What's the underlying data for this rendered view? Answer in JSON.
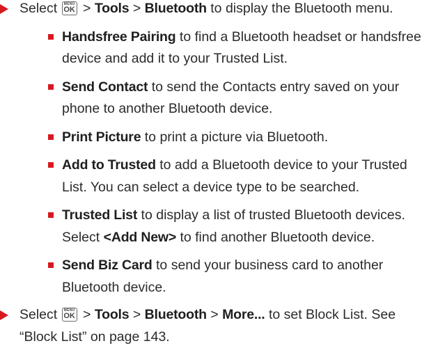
{
  "key_icon": {
    "top": "MENU",
    "bottom": "OK"
  },
  "step1": {
    "select": "Select",
    "sep1": " > ",
    "tools": "Tools",
    "sep2": " > ",
    "bluetooth": "Bluetooth",
    "rest": " to display the Bluetooth menu."
  },
  "items": [
    {
      "term": "Handsfree Pairing",
      "desc": " to find a Bluetooth headset or handsfree device and add it to your Trusted List."
    },
    {
      "term": "Send Contact",
      "desc": " to send the Contacts entry saved on your phone to another Bluetooth device."
    },
    {
      "term": "Print Picture",
      "desc": " to print a picture via Bluetooth."
    },
    {
      "term": "Add to Trusted",
      "desc": " to add a Bluetooth device to your Trusted List. You can select a device type to be searched."
    },
    {
      "term": "Trusted List",
      "desc": " to display a list of trusted Bluetooth devices. Select ",
      "term2": "<Add New>",
      "desc2": " to find another Bluetooth device."
    },
    {
      "term": "Send Biz Card",
      "desc": " to send your business card to another Bluetooth device."
    }
  ],
  "step2": {
    "select": "Select",
    "sep1": " > ",
    "tools": "Tools",
    "sep2": " > ",
    "bluetooth": "Bluetooth",
    "sep3": " > ",
    "more": "More...",
    "rest": " to set Block List. See “Block List” on page 143."
  },
  "colors": {
    "accent": "#d7191f",
    "text": "#2b2b2b"
  }
}
